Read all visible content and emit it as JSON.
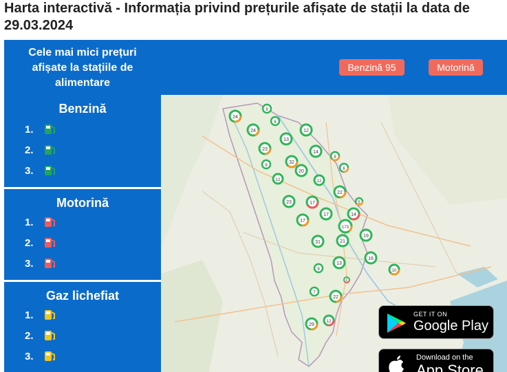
{
  "page": {
    "title": "Harta interactivă - Informația privind prețurile afișate de stații la data de 29.03.2024"
  },
  "header": {
    "caption": "Cele mai mici prețuri afișate la stațiile de alimentare",
    "fuel_buttons": [
      "Benzină 95",
      "Motorină"
    ],
    "accent_color": "#0b6bcb",
    "button_color": "#f06a5c"
  },
  "panels": [
    {
      "title": "Benzină",
      "ranks": [
        "1.",
        "2.",
        "3."
      ],
      "icon": "gas-pump-icon",
      "color": "#22a55a"
    },
    {
      "title": "Motorină",
      "ranks": [
        "1.",
        "2.",
        "3."
      ],
      "icon": "gas-pump-icon",
      "color": "#ef5b5b"
    },
    {
      "title": "Gaz lichefiat",
      "ranks": [
        "1.",
        "2.",
        "3."
      ],
      "icon": "gas-pump-icon",
      "color": "#f2c516"
    }
  ],
  "map": {
    "clusters": [
      "24",
      "9",
      "6",
      "24",
      "13",
      "12",
      "23",
      "14",
      "8",
      "9",
      "32",
      "20",
      "6",
      "12",
      "12",
      "22",
      "23",
      "17",
      "5",
      "17",
      "14",
      "17",
      "173",
      "31",
      "21",
      "19",
      "9",
      "13",
      "16",
      "10",
      "2",
      "7",
      "22",
      "29",
      "12"
    ]
  },
  "stores": {
    "google": {
      "small": "GET IT ON",
      "big": "Google Play"
    },
    "apple": {
      "small": "Download on the",
      "big": "App Store"
    }
  }
}
